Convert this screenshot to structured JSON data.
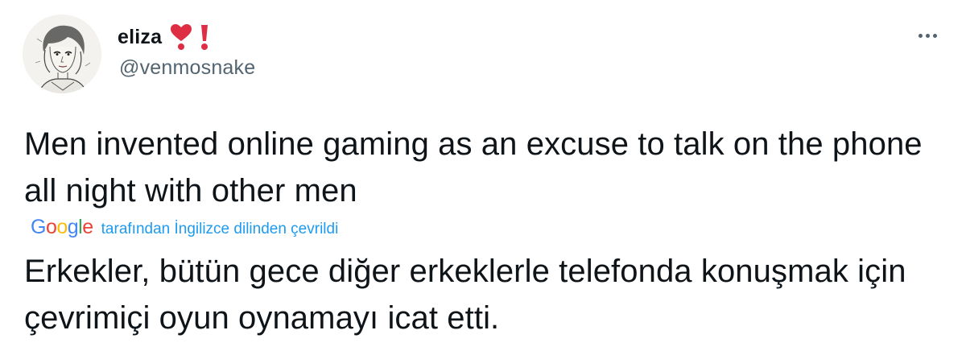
{
  "user": {
    "display_name": "eliza",
    "handle": "@venmosnake",
    "name_emojis": [
      "heart-exclamation-icon",
      "exclamation-icon"
    ]
  },
  "menu": {
    "icon": "more-horizontal-icon"
  },
  "tweet": {
    "text": "Men invented online gaming as an excuse to talk on the phone all night with other men",
    "translated_text": "Erkekler, bütün gece diğer erkeklerle telefonda konuşmak için çevrimiçi oyun oynamayı icat etti."
  },
  "translation": {
    "provider_letters": [
      "G",
      "o",
      "o",
      "g",
      "l",
      "e"
    ],
    "provider_colors": [
      "#4285F4",
      "#EA4335",
      "#FBBC05",
      "#4285F4",
      "#34A853",
      "#EA4335"
    ],
    "label": "tarafından İngilizce dilinden çevrildi"
  },
  "colors": {
    "text_primary": "#0f1419",
    "text_secondary": "#536471",
    "link": "#1d9bf0",
    "emoji_red": "#dd2e44"
  }
}
